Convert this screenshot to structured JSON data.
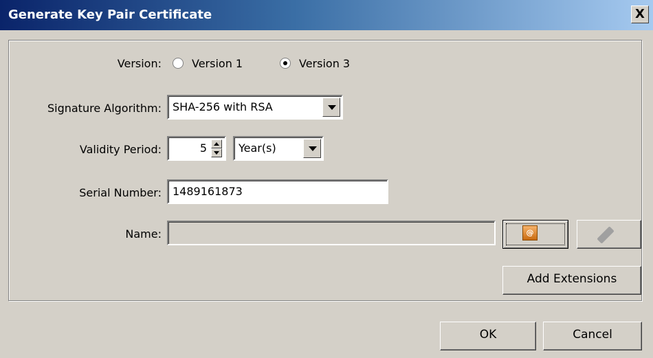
{
  "window": {
    "title": "Generate Key Pair Certificate",
    "close_label": "X"
  },
  "version": {
    "label": "Version:",
    "options": [
      {
        "label": "Version 1",
        "selected": false
      },
      {
        "label": "Version 3",
        "selected": true
      }
    ]
  },
  "signature": {
    "label": "Signature Algorithm:",
    "value": "SHA-256 with RSA"
  },
  "validity": {
    "label": "Validity Period:",
    "amount": "5",
    "unit": "Year(s)"
  },
  "serial": {
    "label": "Serial Number:",
    "value": "1489161873"
  },
  "name": {
    "label": "Name:",
    "value": "",
    "icons": [
      "contacts-icon",
      "pencil-icon"
    ]
  },
  "buttons": {
    "add_extensions": "Add Extensions",
    "ok": "OK",
    "cancel": "Cancel"
  }
}
